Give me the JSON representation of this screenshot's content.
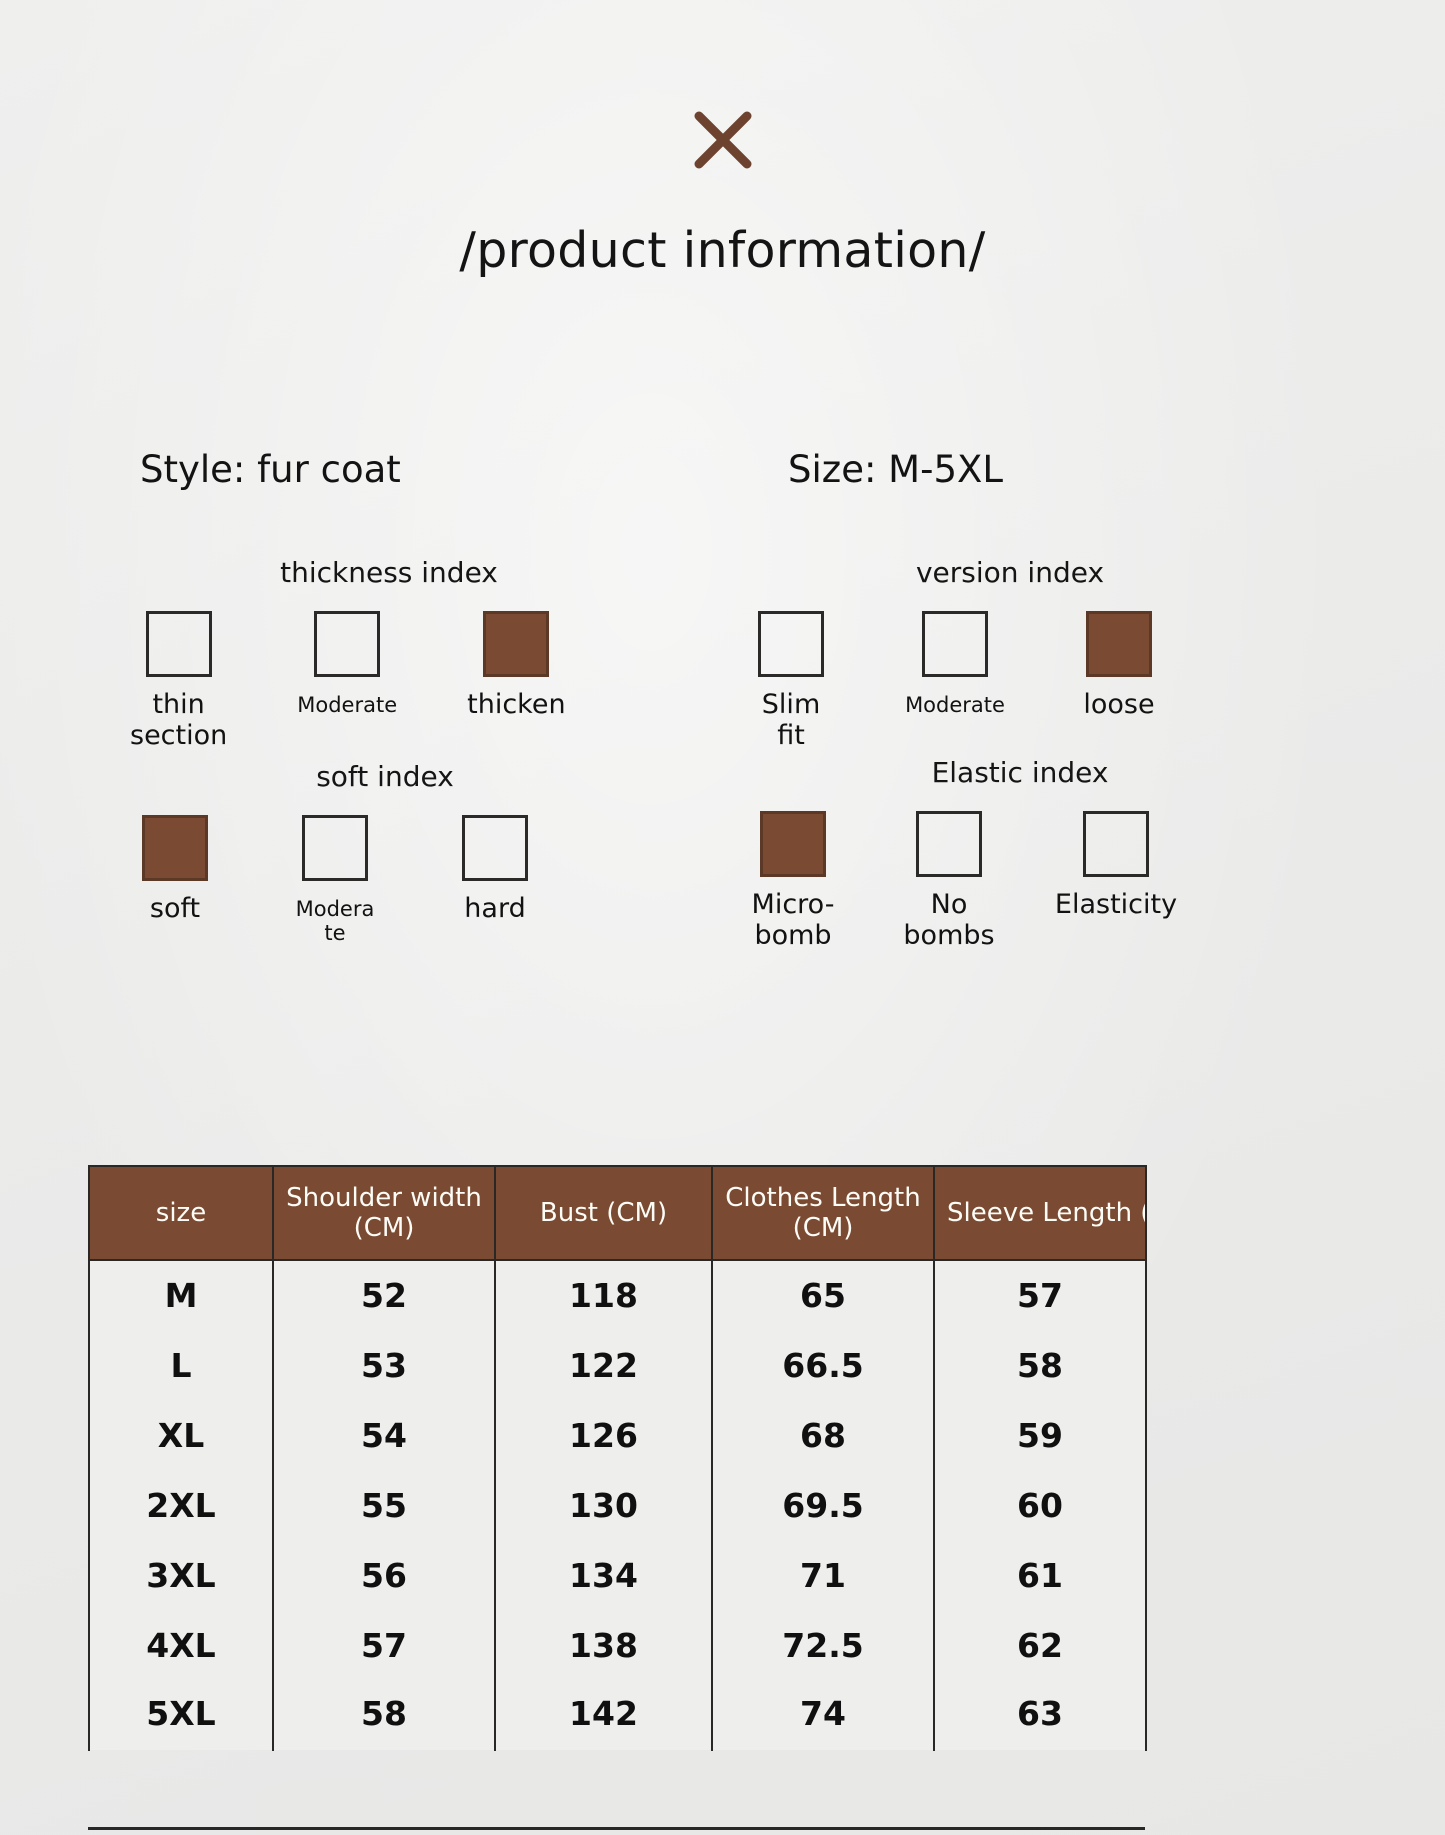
{
  "header": {
    "x_icon": "x-mark-icon",
    "title": "/product information/",
    "accent_color": "#7a4b32"
  },
  "meta": {
    "style": "Style: fur coat",
    "size": "Size: M-5XL"
  },
  "indices": [
    {
      "id": "thickness",
      "heading": "thickness index",
      "options": [
        {
          "label": "thin\nsection",
          "selected": false,
          "small": false
        },
        {
          "label": "Moderate",
          "selected": false,
          "small": true
        },
        {
          "label": "thicken",
          "selected": true,
          "small": false
        }
      ]
    },
    {
      "id": "version",
      "heading": "version index",
      "options": [
        {
          "label": "Slim fit",
          "selected": false,
          "small": false
        },
        {
          "label": "Moderate",
          "selected": false,
          "small": true
        },
        {
          "label": "loose",
          "selected": true,
          "small": false
        }
      ]
    },
    {
      "id": "soft",
      "heading": "soft index",
      "options": [
        {
          "label": "soft",
          "selected": true,
          "small": false
        },
        {
          "label": "Modera\nte",
          "selected": false,
          "small": true
        },
        {
          "label": "hard",
          "selected": false,
          "small": false
        }
      ]
    },
    {
      "id": "elastic",
      "heading": "Elastic index",
      "options": [
        {
          "label": "Micro-\nbomb",
          "selected": true,
          "small": false
        },
        {
          "label": "No\nbombs",
          "selected": false,
          "small": false
        },
        {
          "label": "Elasticity",
          "selected": false,
          "small": false
        }
      ]
    }
  ],
  "size_table": {
    "headers": [
      "size",
      "Shoulder width (CM)",
      "Bust (CM)",
      "Clothes Length (CM)",
      "Sleeve Length (CM)"
    ],
    "rows": [
      [
        "M",
        "52",
        "118",
        "65",
        "57"
      ],
      [
        "L",
        "53",
        "122",
        "66.5",
        "58"
      ],
      [
        "XL",
        "54",
        "126",
        "68",
        "59"
      ],
      [
        "2XL",
        "55",
        "130",
        "69.5",
        "60"
      ],
      [
        "3XL",
        "56",
        "134",
        "71",
        "61"
      ],
      [
        "4XL",
        "57",
        "138",
        "72.5",
        "62"
      ],
      [
        "5XL",
        "58",
        "142",
        "74",
        "63"
      ]
    ]
  },
  "colors": {
    "background": "#ececeb",
    "brown": "#7a4b32",
    "ink": "#111111",
    "table_cell_bg": "#eeeeec"
  }
}
